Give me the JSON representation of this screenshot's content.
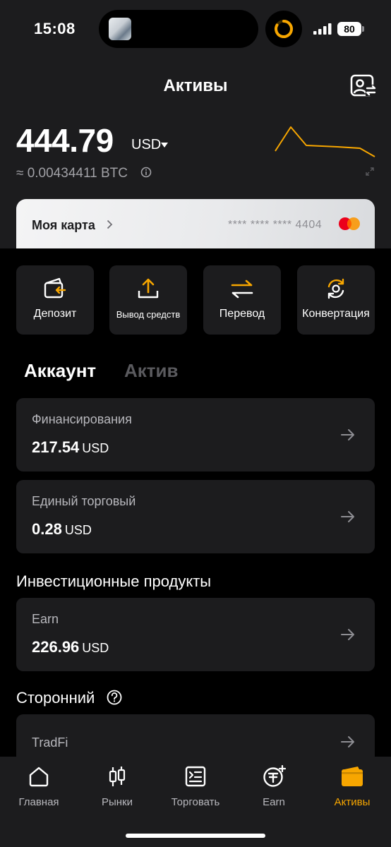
{
  "status_bar": {
    "time": "15:08",
    "battery": "80"
  },
  "header": {
    "title": "Активы"
  },
  "balance": {
    "value": "444.79",
    "currency": "USD",
    "btc_equivalent": "≈ 0.00434411 BTC"
  },
  "card": {
    "label": "Моя карта",
    "number": "**** **** **** 4404"
  },
  "actions": [
    {
      "label": "Депозит",
      "icon": "deposit-wallet-icon"
    },
    {
      "label": "Вывод средств",
      "icon": "withdraw-upload-icon"
    },
    {
      "label": "Перевод",
      "icon": "transfer-arrows-icon"
    },
    {
      "label": "Конвертация",
      "icon": "convert-cycle-icon"
    }
  ],
  "tabs": {
    "account": "Аккаунт",
    "asset": "Актив"
  },
  "accounts": [
    {
      "name": "Финансирования",
      "value": "217.54",
      "currency": "USD"
    },
    {
      "name": "Единый торговый",
      "value": "0.28",
      "currency": "USD"
    }
  ],
  "investment": {
    "title": "Инвестиционные продукты",
    "items": [
      {
        "name": "Earn",
        "value": "226.96",
        "currency": "USD"
      }
    ]
  },
  "third_party": {
    "title": "Сторонний",
    "items": [
      {
        "name": "TradFi"
      }
    ]
  },
  "nav": [
    {
      "label": "Главная",
      "icon": "home-icon"
    },
    {
      "label": "Рынки",
      "icon": "candlestick-icon"
    },
    {
      "label": "Торговать",
      "icon": "trade-icon"
    },
    {
      "label": "Earn",
      "icon": "earn-icon"
    },
    {
      "label": "Активы",
      "icon": "wallet-icon",
      "active": true
    }
  ],
  "colors": {
    "accent": "#f7a600",
    "background": "#000000",
    "surface": "#1c1c1e"
  }
}
